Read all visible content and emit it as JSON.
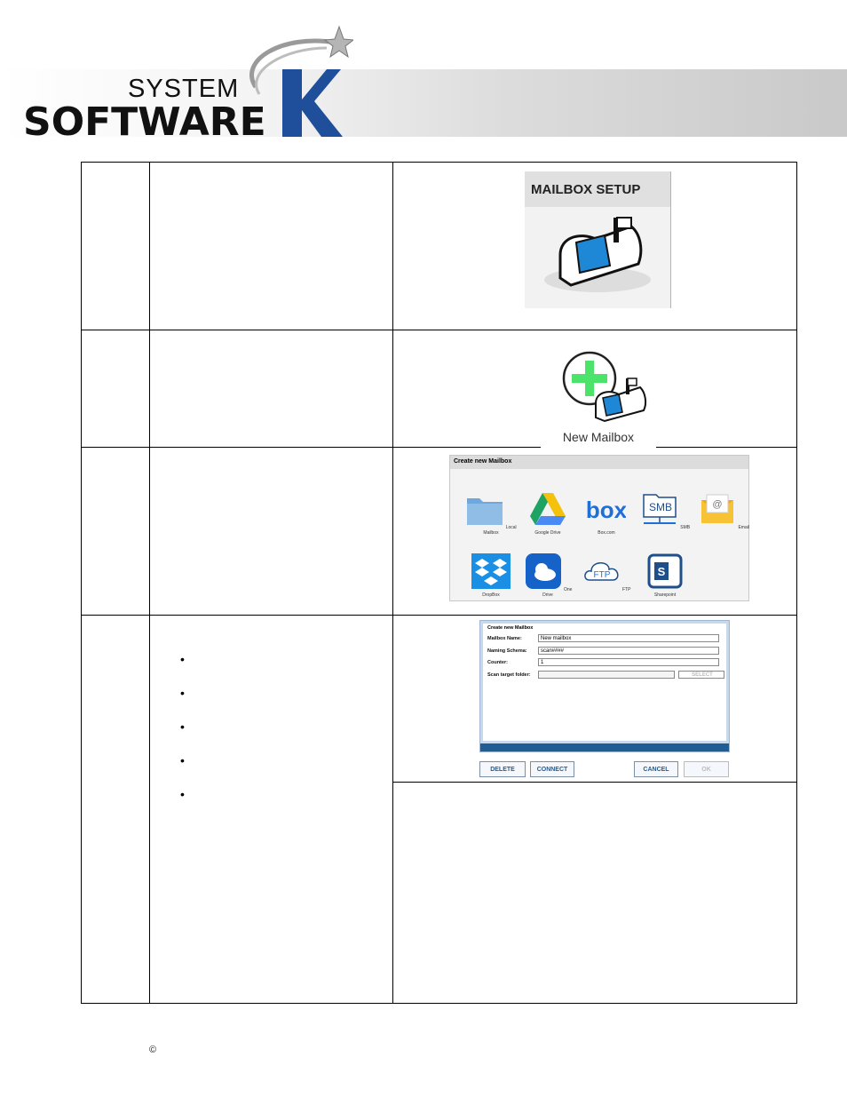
{
  "brand": {
    "line1": "SYSTEM",
    "line2": "SOFTWARE",
    "letter": "K",
    "accent_color": "#1f4e9a"
  },
  "row1": {
    "panel_title": "MAILBOX SETUP",
    "icon": "mailbox-icon"
  },
  "row2": {
    "label": "New Mailbox",
    "icon": "new-mailbox-icon"
  },
  "row3": {
    "title": "Create new Mailbox",
    "services": [
      {
        "label": "Local Mailbox",
        "icon": "folder-icon"
      },
      {
        "label": "Google Drive",
        "icon": "google-drive-icon"
      },
      {
        "label": "Box.com",
        "icon": "box-icon",
        "text": "box"
      },
      {
        "label": "SMB",
        "icon": "smb-icon",
        "text": "SMB"
      },
      {
        "label": "Email",
        "icon": "email-icon",
        "text": "@"
      },
      {
        "label": "DropBox",
        "icon": "dropbox-icon"
      },
      {
        "label": "One Drive",
        "icon": "onedrive-icon"
      },
      {
        "label": "FTP",
        "icon": "ftp-icon",
        "text": "FTP"
      },
      {
        "label": "Sharepoint",
        "icon": "sharepoint-icon",
        "text": "S"
      }
    ]
  },
  "row4": {
    "form": {
      "title": "Create new Mailbox",
      "fields": [
        {
          "label": "Mailbox Name:",
          "value": "New mailbox"
        },
        {
          "label": "Naming Schema:",
          "value": "scan####"
        },
        {
          "label": "Counter:",
          "value": "1"
        },
        {
          "label": "Scan target folder:",
          "value": ""
        }
      ],
      "select_label": "SELECT"
    },
    "buttons": {
      "delete": "DELETE",
      "connect": "CONNECT",
      "cancel": "CANCEL",
      "ok": "OK"
    },
    "bullets": 5
  },
  "footer": {
    "copyright": "©"
  }
}
